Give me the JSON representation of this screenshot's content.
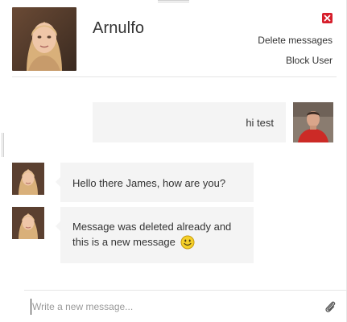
{
  "header": {
    "contact_name": "Arnulfo",
    "delete_messages_label": "Delete messages",
    "block_user_label": "Block User",
    "close_icon": "close-icon",
    "close_color": "#d61f2c"
  },
  "messages": [
    {
      "direction": "outgoing",
      "text": "hi test",
      "avatar": "user-avatar"
    },
    {
      "direction": "incoming",
      "text": "Hello there James, how are you?",
      "avatar": "contact-avatar"
    },
    {
      "direction": "incoming",
      "text": "Message was deleted already and this is a new message",
      "emoji": "smiley-icon",
      "avatar": "contact-avatar"
    }
  ],
  "composer": {
    "placeholder": "Write a new message...",
    "value": "",
    "attach_icon": "paperclip-icon"
  },
  "colors": {
    "bubble_background": "#f4f4f4",
    "text": "#333333",
    "divider": "#e5e5e5"
  }
}
